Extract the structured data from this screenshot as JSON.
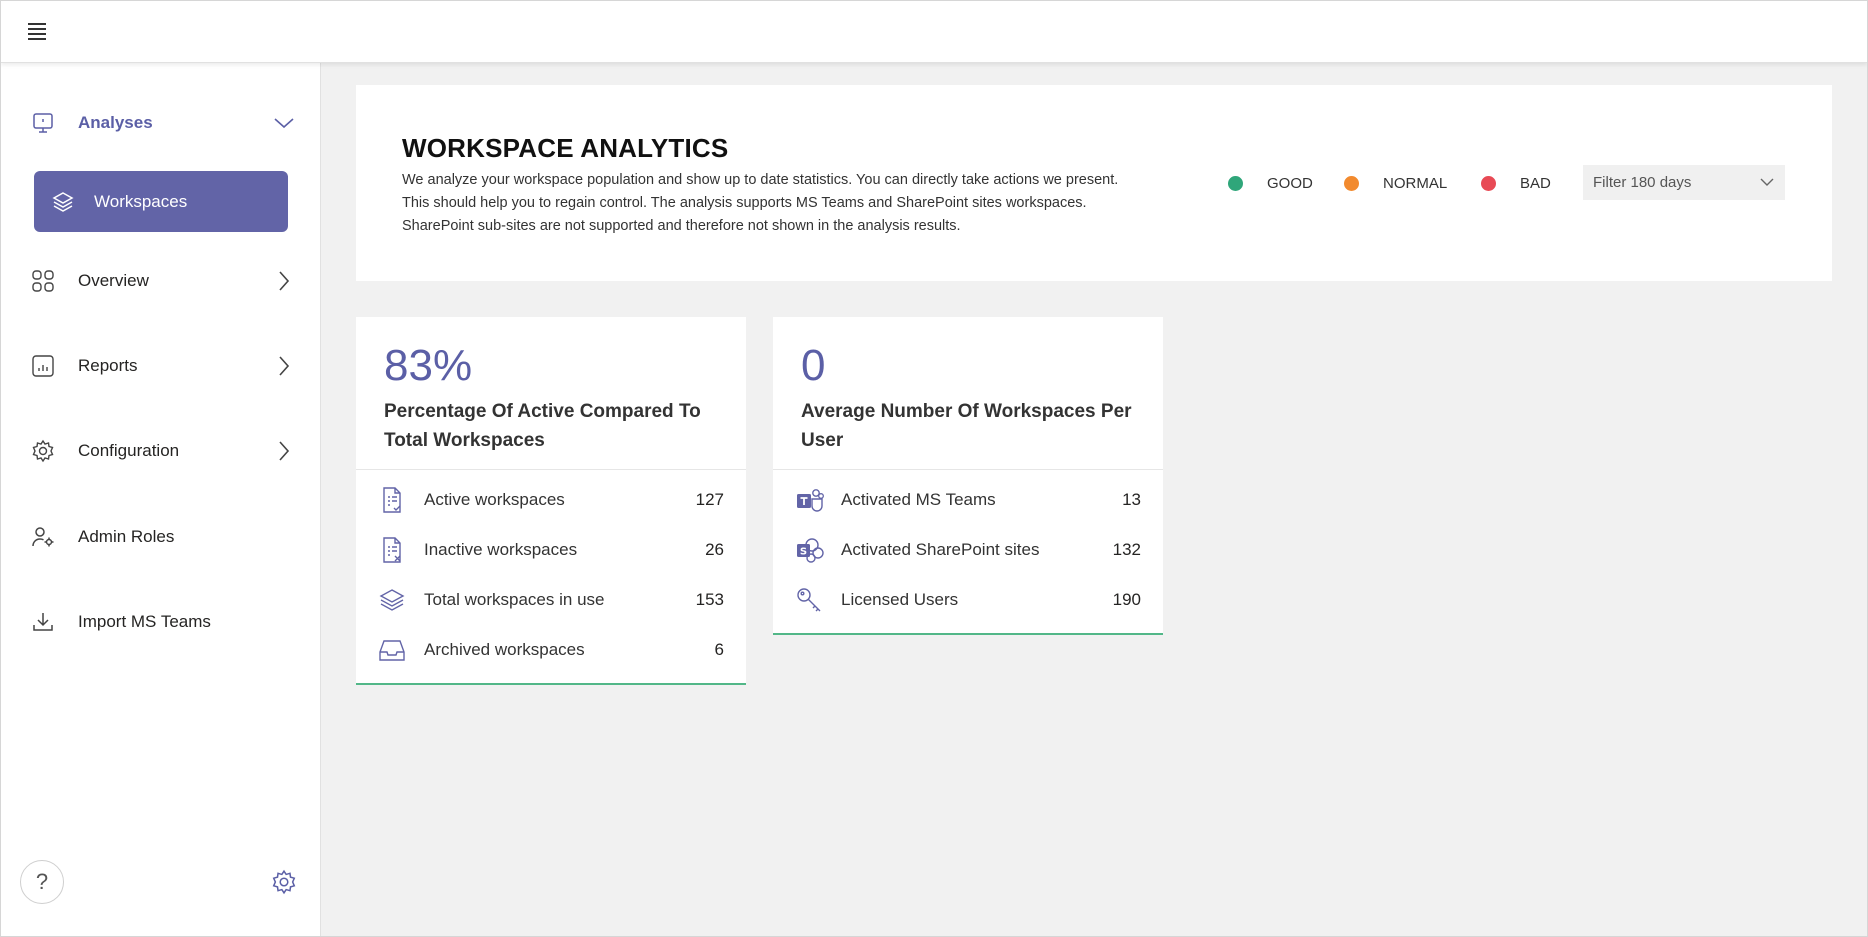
{
  "topbar": {
    "menu_icon": "hamburger-menu-icon"
  },
  "sidebar": {
    "analyses": {
      "label": "Analyses",
      "icon": "monitor-icon"
    },
    "workspaces": {
      "label": "Workspaces",
      "icon": "layers-icon"
    },
    "items": [
      {
        "label": "Overview",
        "icon": "grid-icon"
      },
      {
        "label": "Reports",
        "icon": "bar-chart-icon"
      },
      {
        "label": "Configuration",
        "icon": "gear-icon"
      },
      {
        "label": "Admin Roles",
        "icon": "user-gear-icon"
      },
      {
        "label": "Import MS Teams",
        "icon": "download-icon"
      }
    ],
    "help_label": "?"
  },
  "header": {
    "title": "WORKSPACE ANALYTICS",
    "description": "We analyze your workspace population and show up to date statistics. You can directly take actions we present. This should help you to regain control. The analysis supports MS Teams and SharePoint sites workspaces. SharePoint sub-sites are not supported and therefore not shown in the analysis results.",
    "legend": [
      {
        "label": "GOOD",
        "color": "#2fa67a"
      },
      {
        "label": "NORMAL",
        "color": "#f28a2e"
      },
      {
        "label": "BAD",
        "color": "#e84a55"
      }
    ],
    "filter": {
      "value": "Filter 180 days"
    }
  },
  "cards": [
    {
      "value": "83%",
      "title": "Percentage Of Active Compared To Total Workspaces",
      "rows": [
        {
          "label": "Active workspaces",
          "value": "127",
          "icon": "document-check-icon"
        },
        {
          "label": "Inactive workspaces",
          "value": "26",
          "icon": "document-x-icon"
        },
        {
          "label": "Total workspaces in use",
          "value": "153",
          "icon": "layers-icon"
        },
        {
          "label": "Archived workspaces",
          "value": "6",
          "icon": "inbox-icon"
        }
      ]
    },
    {
      "value": "0",
      "title": "Average Number Of Workspaces Per User",
      "rows": [
        {
          "label": "Activated MS Teams",
          "value": "13",
          "icon": "teams-icon"
        },
        {
          "label": "Activated SharePoint sites",
          "value": "132",
          "icon": "sharepoint-icon"
        },
        {
          "label": "Licensed Users",
          "value": "190",
          "icon": "key-icon"
        }
      ]
    }
  ],
  "colors": {
    "accent": "#6264a7",
    "good_line": "#52b788",
    "background": "#f1f1f1"
  }
}
